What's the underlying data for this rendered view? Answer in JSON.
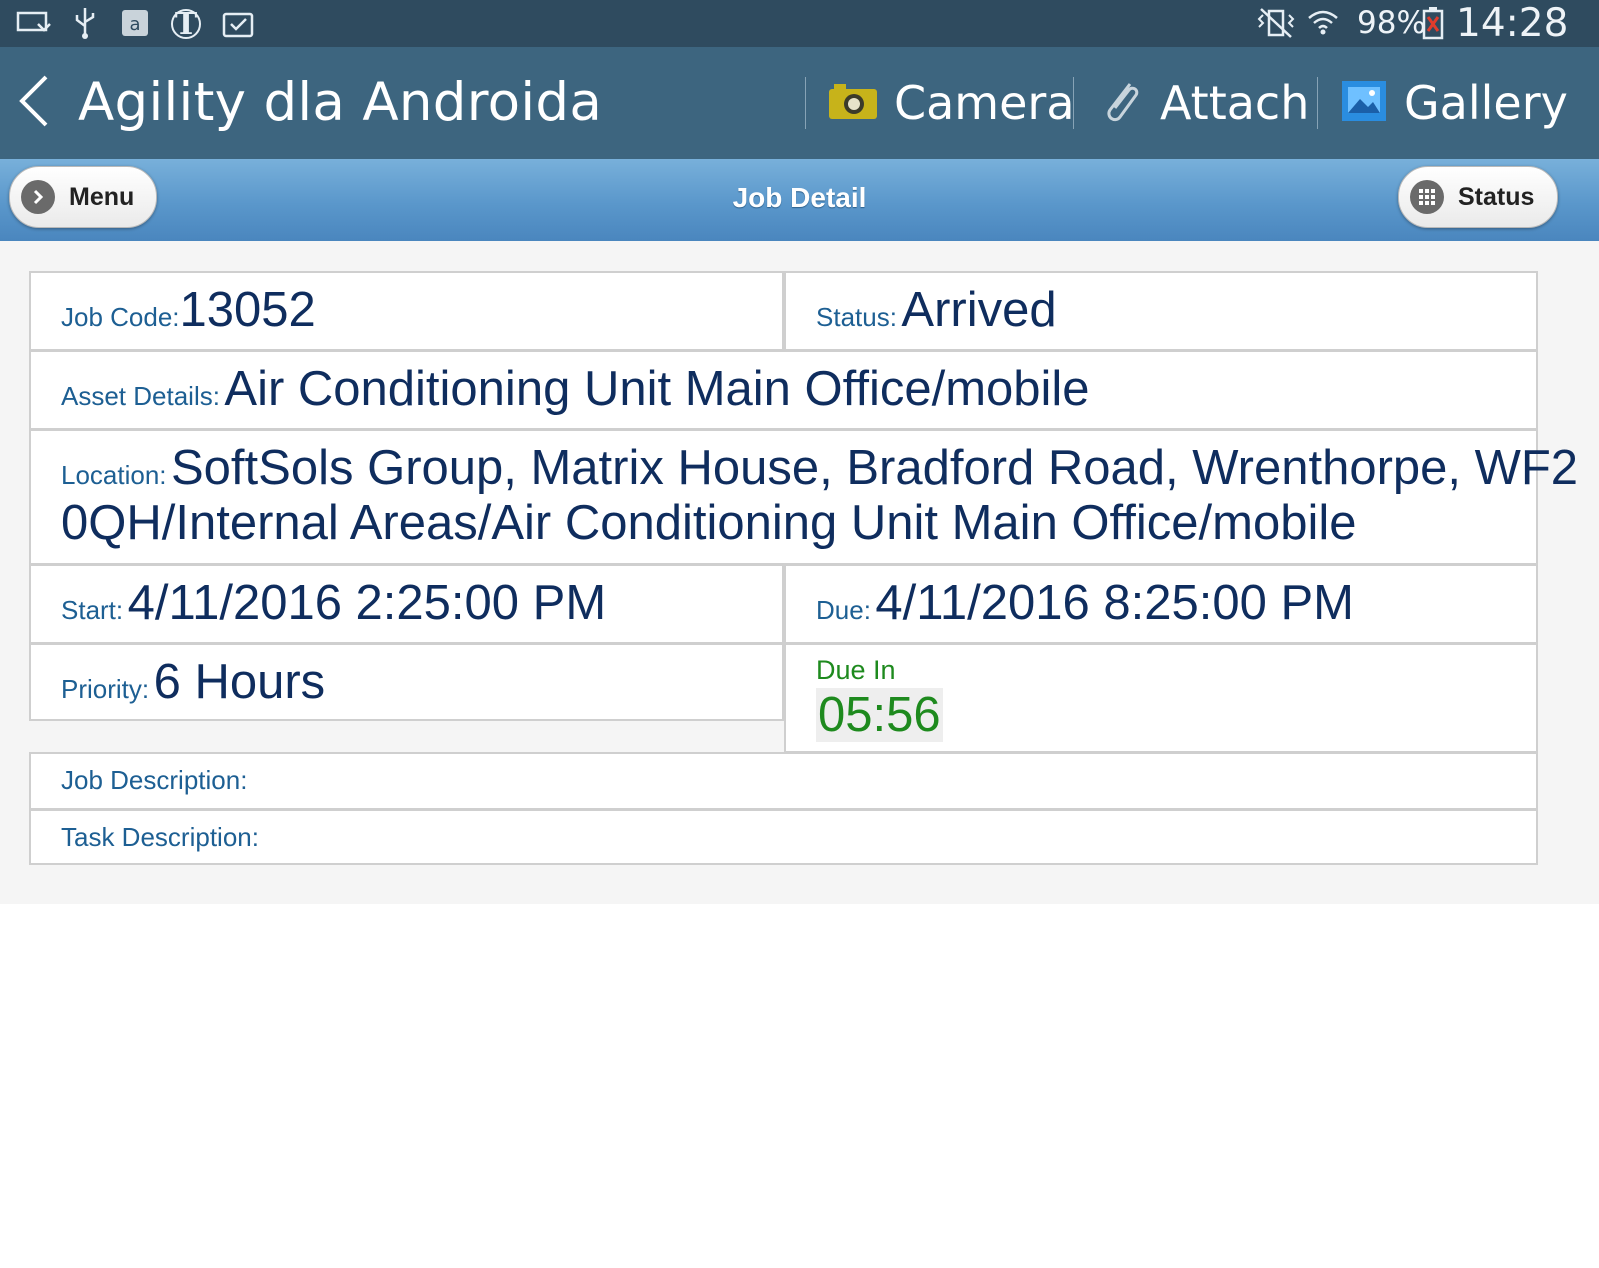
{
  "status_bar": {
    "left_icons": [
      "screen-mirror-icon",
      "usb-icon",
      "amazon-icon",
      "nyt-icon",
      "clipboard-check-icon"
    ],
    "right_icons": [
      "mute-vibrate-icon",
      "wifi-icon",
      "battery-icon"
    ],
    "battery": "98%",
    "time": "14:28"
  },
  "action_bar": {
    "title": "Agility dla Androida",
    "actions": [
      {
        "label": "Camera",
        "icon": "camera-icon"
      },
      {
        "label": "Attach",
        "icon": "paperclip-icon"
      },
      {
        "label": "Gallery",
        "icon": "gallery-icon"
      }
    ]
  },
  "header": {
    "title": "Job Detail",
    "left_button": {
      "label": "Menu",
      "icon": "chevron-right-icon"
    },
    "right_button": {
      "label": "Status",
      "icon": "grid-icon"
    }
  },
  "job": {
    "job_code_label": "Job Code:",
    "job_code": "13052",
    "status_label": "Status:",
    "status": "Arrived",
    "asset_label": "Asset Details:",
    "asset": "Air Conditioning Unit Main Office/mobile",
    "location_label": "Location:",
    "location_line1": "SoftSols Group, Matrix House, Bradford Road, Wrenthorpe, WF2",
    "location_line2": "0QH/Internal Areas/Air Conditioning Unit Main Office/mobile",
    "start_label": "Start:",
    "start": "4/11/2016 2:25:00 PM",
    "due_label": "Due:",
    "due": "4/11/2016 8:25:00 PM",
    "priority_label": "Priority:",
    "priority": "6 Hours",
    "due_in_label": "Due In",
    "due_in": "05:56",
    "job_description_label": "Job Description:",
    "task_description_label": "Task Description:"
  },
  "colors": {
    "status_bar": "#2f4b5f",
    "action_bar": "#3d657f",
    "header_gradient_top": "#78b0da",
    "header_gradient_bottom": "#4a86be",
    "label_blue": "#1d5f93",
    "value_navy": "#0f2d5e",
    "due_in_green": "#1e8a1e"
  }
}
